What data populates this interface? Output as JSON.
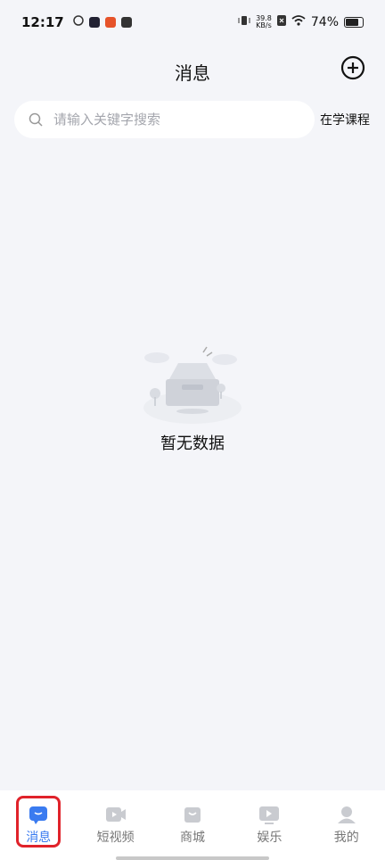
{
  "status_bar": {
    "time": "12:17",
    "net_speed_value": "39.8",
    "net_speed_unit": "KB/s",
    "battery": "74%"
  },
  "header": {
    "title": "消息"
  },
  "search": {
    "placeholder": "请输入关键字搜索",
    "value": ""
  },
  "course_link": "在学课程",
  "empty_state": {
    "text": "暂无数据"
  },
  "tabs": [
    {
      "label": "消息",
      "icon": "chat-icon",
      "active": true
    },
    {
      "label": "短视频",
      "icon": "video-icon",
      "active": false
    },
    {
      "label": "商城",
      "icon": "shop-icon",
      "active": false
    },
    {
      "label": "娱乐",
      "icon": "play-icon",
      "active": false
    },
    {
      "label": "我的",
      "icon": "profile-icon",
      "active": false
    }
  ],
  "colors": {
    "accent": "#3a7bf0",
    "highlight": "#e0222a",
    "background": "#f4f5f9"
  }
}
